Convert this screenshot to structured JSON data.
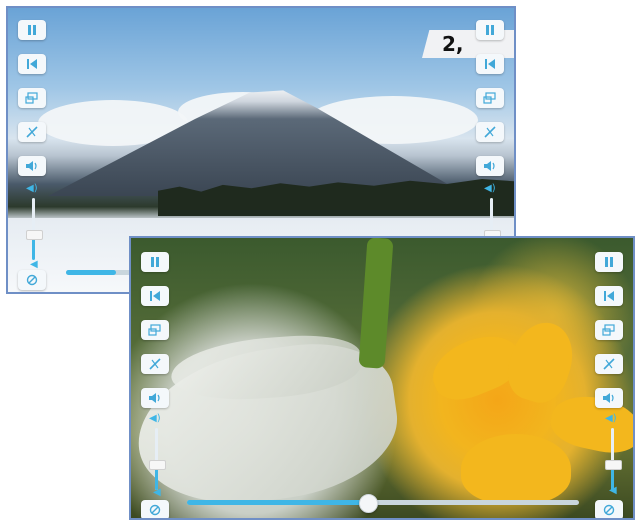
{
  "players": [
    {
      "id": "mountain",
      "counter": "2,",
      "volume_level": 0.38,
      "seek_progress": 0.12,
      "left_controls": [
        "pause-icon",
        "skip-back-icon",
        "screen-mode-icon",
        "effect-icon",
        "speaker-icon"
      ],
      "right_controls": [
        "pause-icon",
        "skip-back-icon",
        "screen-mode-icon",
        "effect-icon",
        "speaker-icon"
      ]
    },
    {
      "id": "butterfly",
      "volume_level": 0.38,
      "seek_progress": 0.46,
      "left_controls": [
        "pause-icon",
        "skip-back-icon",
        "screen-mode-icon",
        "effect-icon",
        "speaker-icon"
      ],
      "right_controls": [
        "pause-icon",
        "skip-back-icon",
        "screen-mode-icon",
        "effect-icon",
        "speaker-icon"
      ]
    }
  ],
  "colors": {
    "accent": "#3fb6e6",
    "button_bg": "#f4f8fb",
    "frame": "#6f8fc6"
  }
}
